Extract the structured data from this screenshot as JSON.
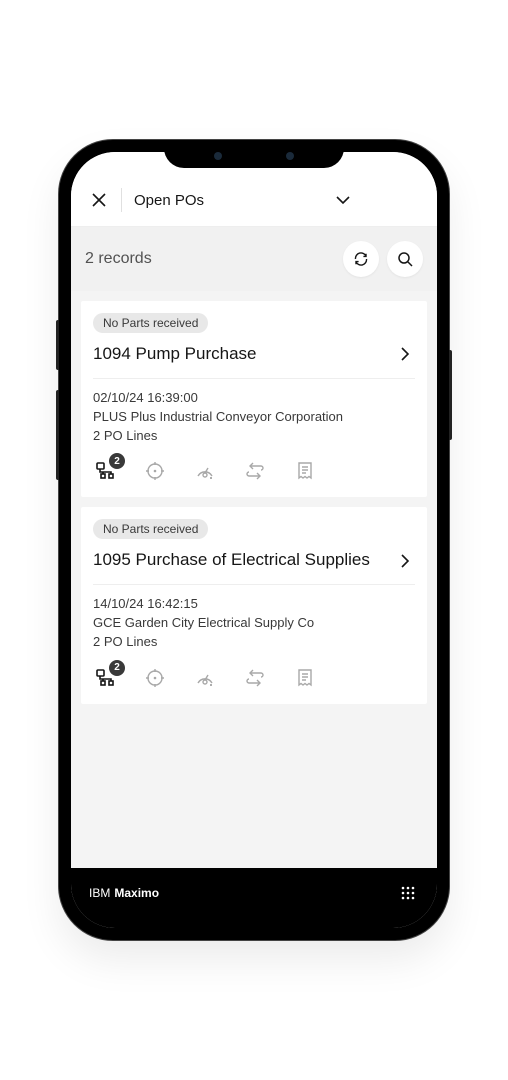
{
  "header": {
    "title": "Open POs"
  },
  "subheader": {
    "records_label": "2 records"
  },
  "records": [
    {
      "badge": "No Parts received",
      "title": "1094 Pump Purchase",
      "timestamp": "02/10/24 16:39:00",
      "supplier": "PLUS Plus Industrial Conveyor Corporation",
      "lines": "2 PO Lines",
      "tree_count": "2"
    },
    {
      "badge": "No Parts received",
      "title": "1095 Purchase of Electrical Supplies",
      "timestamp": "14/10/24 16:42:15",
      "supplier": "GCE Garden City Electrical Supply Co",
      "lines": "2 PO Lines",
      "tree_count": "2"
    }
  ],
  "footer": {
    "brand_pre": "IBM",
    "brand_name": "Maximo"
  },
  "colors": {
    "icon_active": "#161616",
    "icon_muted": "#a8a8a8",
    "badge_bg": "#e8e8e8"
  }
}
